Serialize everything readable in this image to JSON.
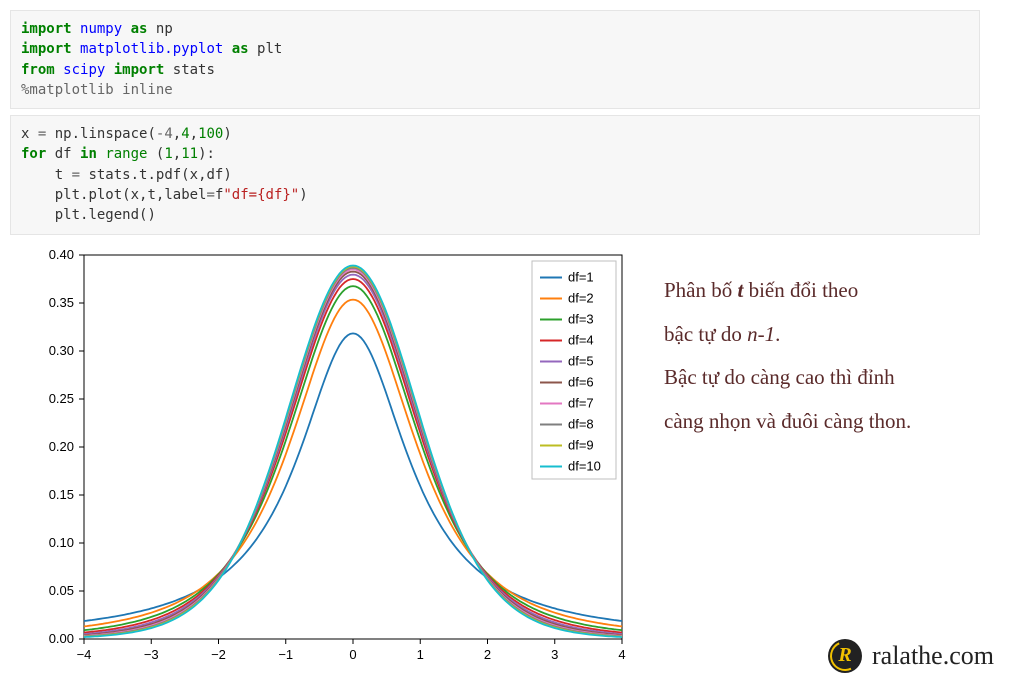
{
  "code_cell_1": {
    "line1": {
      "import": "import",
      "m": "numpy",
      "as": "as",
      "alias": "np"
    },
    "line2": {
      "import": "import",
      "m": "matplotlib.pyplot",
      "as": "as",
      "alias": "plt"
    },
    "line3": {
      "from": "from",
      "m": "scipy",
      "import": "import",
      "name": "stats"
    },
    "line4": "%matplotlib inline"
  },
  "code_cell_2": {
    "l1": {
      "x": "x",
      "eq": "=",
      "np": "np",
      "linspace": ".linspace(",
      "a": "-4",
      "c1": ",",
      "b": "4",
      "c2": ",",
      "n": "100",
      "close": ")"
    },
    "l2": {
      "for": "for",
      "df": "df",
      "in": "in",
      "range": "range",
      "open": " (",
      "a": "1",
      "c": ",",
      "b": "11",
      "close": "):"
    },
    "l3": {
      "t": "    t",
      "eq": " = ",
      "stats": "stats",
      "tpdf": ".t.pdf(",
      "x": "x",
      ",": ",",
      "df": "df",
      "close": ")"
    },
    "l4": {
      "plt": "    plt",
      "plot": ".plot(",
      "x": "x",
      "c1": ",",
      "t": "t",
      "c2": ",",
      "label": "label",
      "eq": "=",
      "f": "f",
      "str": "\"df={df}\"",
      "close": ")"
    },
    "l5": {
      "plt": "    plt",
      "legend": ".legend()"
    }
  },
  "annotation": {
    "line1a": "Phân bố ",
    "line1b": "t",
    "line1c": " biến đổi theo",
    "line2a": "bậc tự do ",
    "line2b": "n-1",
    "line2c": ".",
    "line3": "Bậc tự do càng cao thì đỉnh",
    "line4": "càng nhọn và đuôi càng thon."
  },
  "footer": {
    "site": "ralathe.com"
  },
  "chart_data": {
    "type": "line",
    "xlabel": "",
    "ylabel": "",
    "title": "",
    "xlim": [
      -4,
      4
    ],
    "ylim": [
      0,
      0.4
    ],
    "xticks": [
      -4,
      -3,
      -2,
      -1,
      0,
      1,
      2,
      3,
      4
    ],
    "yticks": [
      0.0,
      0.05,
      0.1,
      0.15,
      0.2,
      0.25,
      0.3,
      0.35,
      0.4
    ],
    "legend_title": "",
    "legend_position": "upper right",
    "x": [
      -4.0,
      -3.5,
      -3.0,
      -2.5,
      -2.0,
      -1.5,
      -1.0,
      -0.5,
      0.0,
      0.5,
      1.0,
      1.5,
      2.0,
      2.5,
      3.0,
      3.5,
      4.0
    ],
    "series": [
      {
        "name": "df=1",
        "color": "#1f77b4",
        "values": [
          0.019,
          0.024,
          0.032,
          0.044,
          0.064,
          0.098,
          0.159,
          0.255,
          0.318,
          0.255,
          0.159,
          0.098,
          0.064,
          0.044,
          0.032,
          0.024,
          0.019
        ]
      },
      {
        "name": "df=2",
        "color": "#ff7f0e",
        "values": [
          0.013,
          0.018,
          0.027,
          0.042,
          0.068,
          0.114,
          0.193,
          0.296,
          0.354,
          0.296,
          0.193,
          0.114,
          0.068,
          0.042,
          0.027,
          0.018,
          0.013
        ]
      },
      {
        "name": "df=3",
        "color": "#2ca02c",
        "values": [
          0.009,
          0.014,
          0.023,
          0.039,
          0.068,
          0.12,
          0.207,
          0.313,
          0.368,
          0.313,
          0.207,
          0.12,
          0.068,
          0.039,
          0.023,
          0.014,
          0.009
        ]
      },
      {
        "name": "df=4",
        "color": "#d62728",
        "values": [
          0.007,
          0.012,
          0.02,
          0.037,
          0.066,
          0.123,
          0.215,
          0.322,
          0.375,
          0.322,
          0.215,
          0.123,
          0.066,
          0.037,
          0.02,
          0.012,
          0.007
        ]
      },
      {
        "name": "df=5",
        "color": "#9467bd",
        "values": [
          0.006,
          0.01,
          0.017,
          0.035,
          0.065,
          0.125,
          0.22,
          0.328,
          0.38,
          0.328,
          0.22,
          0.125,
          0.065,
          0.035,
          0.017,
          0.01,
          0.006
        ]
      },
      {
        "name": "df=6",
        "color": "#8c564b",
        "values": [
          0.005,
          0.009,
          0.016,
          0.033,
          0.064,
          0.126,
          0.223,
          0.332,
          0.383,
          0.332,
          0.223,
          0.126,
          0.064,
          0.033,
          0.016,
          0.009,
          0.005
        ]
      },
      {
        "name": "df=7",
        "color": "#e377c2",
        "values": [
          0.004,
          0.008,
          0.015,
          0.032,
          0.063,
          0.127,
          0.226,
          0.335,
          0.385,
          0.335,
          0.226,
          0.127,
          0.063,
          0.032,
          0.015,
          0.008,
          0.004
        ]
      },
      {
        "name": "df=8",
        "color": "#7f7f7f",
        "values": [
          0.004,
          0.007,
          0.014,
          0.031,
          0.062,
          0.128,
          0.228,
          0.337,
          0.387,
          0.337,
          0.228,
          0.128,
          0.062,
          0.031,
          0.014,
          0.007,
          0.004
        ]
      },
      {
        "name": "df=9",
        "color": "#bcbd22",
        "values": [
          0.003,
          0.006,
          0.013,
          0.03,
          0.061,
          0.128,
          0.229,
          0.339,
          0.388,
          0.339,
          0.229,
          0.128,
          0.061,
          0.03,
          0.013,
          0.006,
          0.003
        ]
      },
      {
        "name": "df=10",
        "color": "#17becf",
        "values": [
          0.003,
          0.006,
          0.012,
          0.029,
          0.061,
          0.129,
          0.23,
          0.34,
          0.389,
          0.34,
          0.23,
          0.129,
          0.061,
          0.029,
          0.012,
          0.006,
          0.003
        ]
      }
    ]
  }
}
